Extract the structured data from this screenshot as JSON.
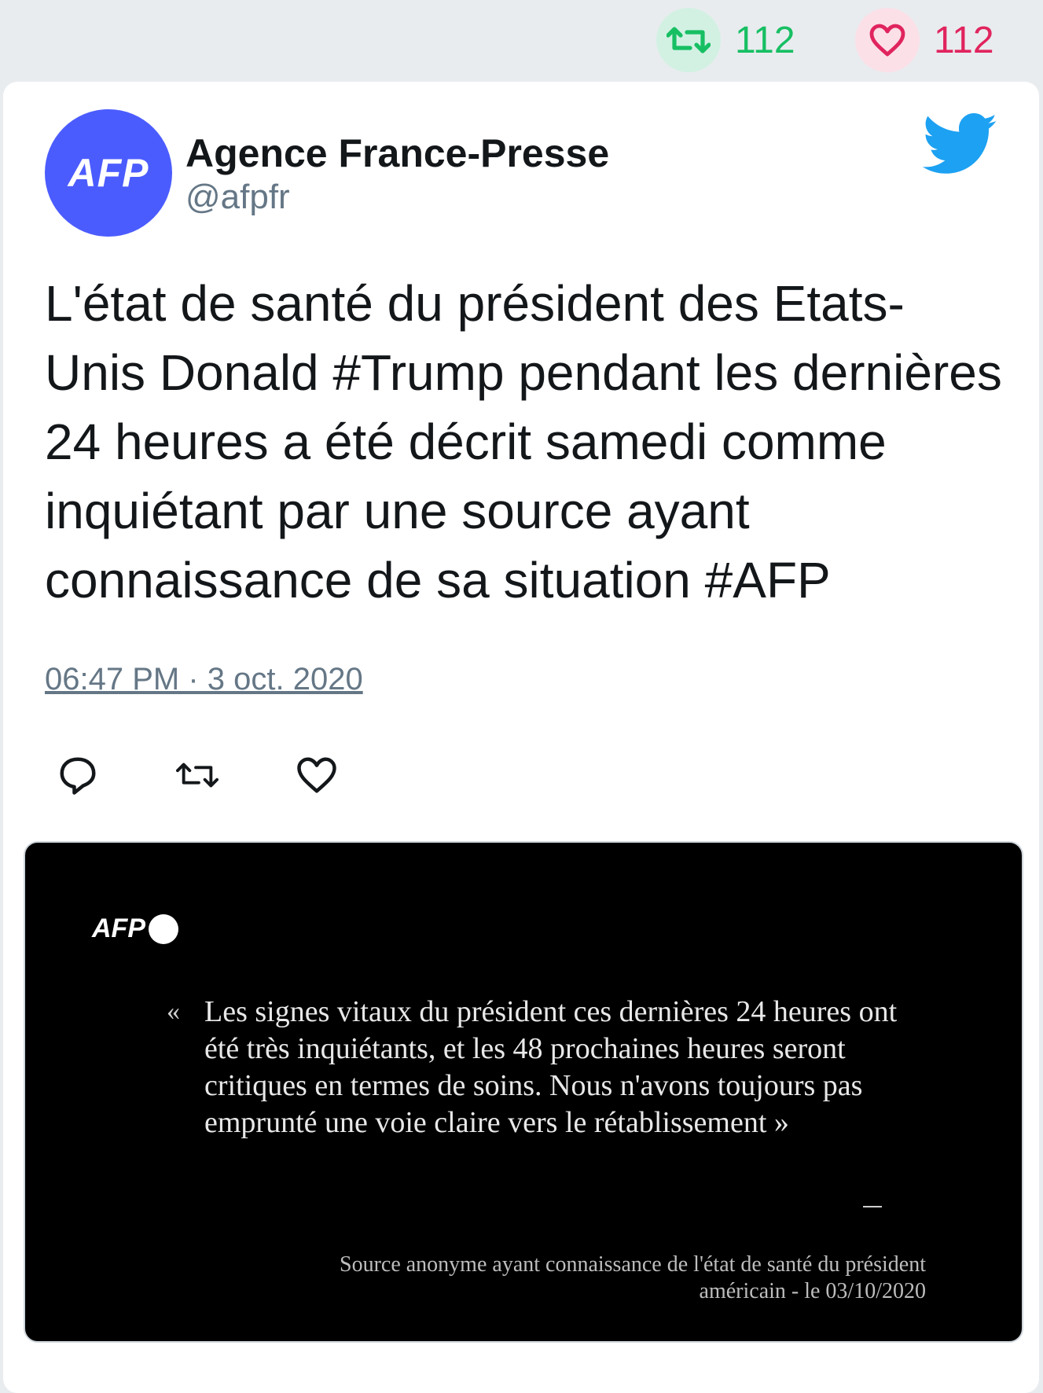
{
  "stats": {
    "retweets": "112",
    "likes": "112",
    "retweet_color": "#17bf63",
    "like_color": "#e0245e",
    "retweet_icon": "retweet-icon",
    "like_icon": "heart-icon"
  },
  "tweet": {
    "author_name": "Agence France-Presse",
    "handle": "@afpfr",
    "avatar_text": "AFP",
    "avatar_color": "#4b5cff",
    "platform_icon": "twitter-bird-icon",
    "text": "L'état de santé du président des Etats-Unis Donald #Trump pendant les dernières 24 heures a été décrit samedi comme inquiétant par une source ayant connaissance de sa situation #AFP",
    "timestamp": "06:47 PM · 3 oct. 2020",
    "actions": [
      "reply-icon",
      "retweet-icon",
      "like-icon"
    ]
  },
  "media": {
    "logo_text": "AFP",
    "quote_open": "«",
    "quote": "Les signes vitaux du président ces dernières 24 heures ont été très inquiétants, et les 48 prochaines heures seront critiques en termes de soins. Nous n'avons toujours pas emprunté une voie claire vers le rétablissement »",
    "source_line1": "Source anonyme ayant connaissance de l'état de santé du président",
    "source_line2": "américain - le 03/10/2020"
  }
}
